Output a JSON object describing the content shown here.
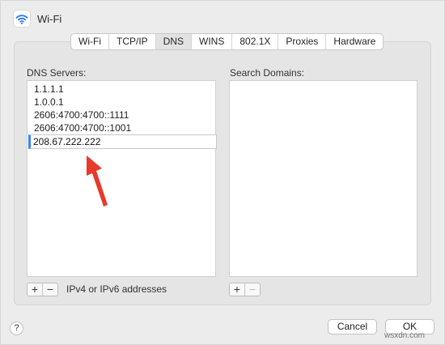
{
  "header": {
    "title": "Wi-Fi",
    "icon": "wifi-icon"
  },
  "tabs": [
    {
      "label": "Wi-Fi",
      "active": false
    },
    {
      "label": "TCP/IP",
      "active": false
    },
    {
      "label": "DNS",
      "active": true
    },
    {
      "label": "WINS",
      "active": false
    },
    {
      "label": "802.1X",
      "active": false
    },
    {
      "label": "Proxies",
      "active": false
    },
    {
      "label": "Hardware",
      "active": false
    }
  ],
  "dns": {
    "label": "DNS Servers:",
    "servers": [
      "1.1.1.1",
      "1.0.0.1",
      "2606:4700:4700::1111",
      "2606:4700:4700::1001"
    ],
    "editing_value": "208.67.222.222",
    "hint": "IPv4 or IPv6 addresses",
    "add_label": "+",
    "remove_label": "−"
  },
  "search": {
    "label": "Search Domains:",
    "add_label": "+",
    "remove_label": "−"
  },
  "footer": {
    "help_label": "?",
    "cancel_label": "Cancel",
    "ok_label": "OK"
  },
  "watermark": "wsxdn.com",
  "colors": {
    "accent": "#3e86ea",
    "arrow": "#e8392b"
  }
}
